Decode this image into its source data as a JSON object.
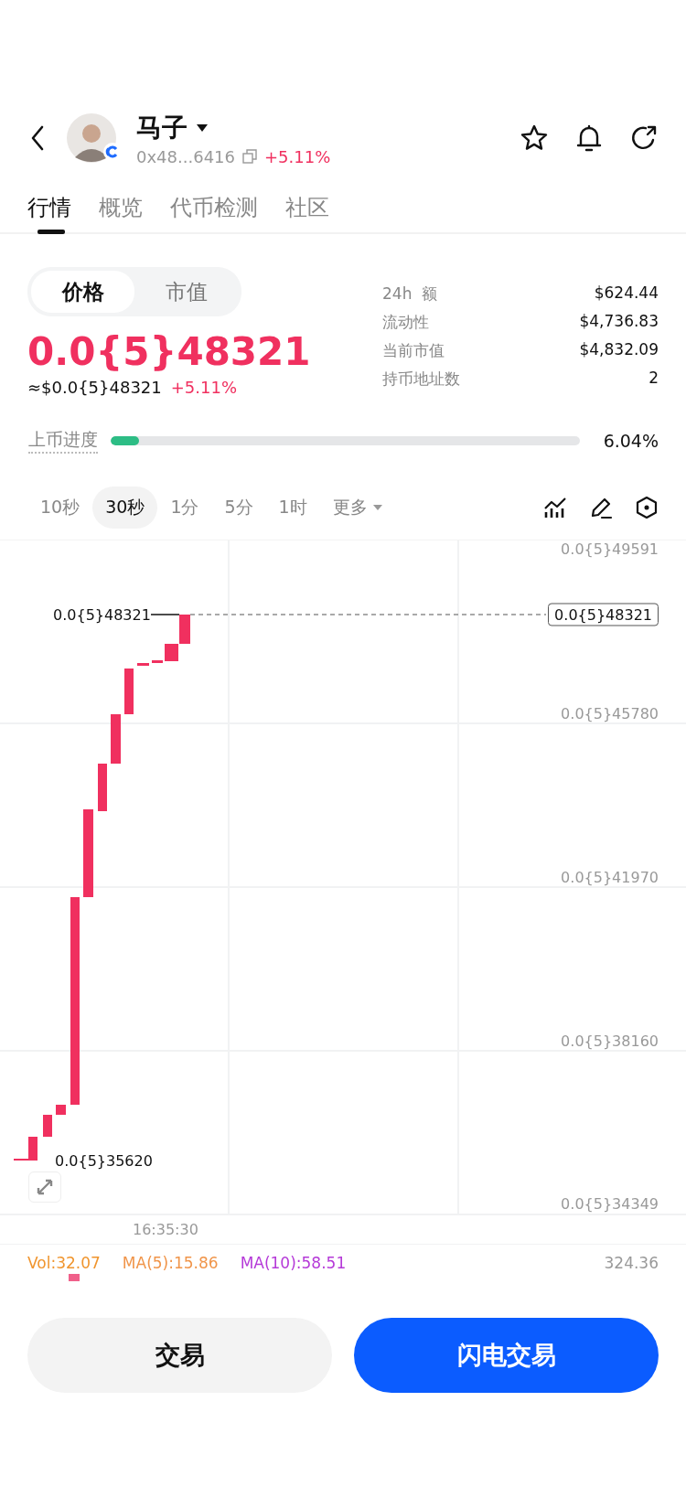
{
  "header": {
    "title": "马子",
    "address": "0x48...6416",
    "change": "+5.11%"
  },
  "tabs": [
    {
      "label": "行情",
      "selected": true
    },
    {
      "label": "概览",
      "selected": false
    },
    {
      "label": "代币检测",
      "selected": false
    },
    {
      "label": "社区",
      "selected": false
    }
  ],
  "mode_toggle": [
    {
      "label": "价格",
      "selected": true
    },
    {
      "label": "市值",
      "selected": false
    }
  ],
  "price": "0.0{5}48321",
  "price_usd": "≈$0.0{5}48321",
  "price_change": "+5.11%",
  "stats": [
    {
      "label": "24h  额",
      "value": "$624.44"
    },
    {
      "label": "流动性",
      "value": "$4,736.83"
    },
    {
      "label": "当前市值",
      "value": "$4,832.09"
    },
    {
      "label": "持币地址数",
      "value": "2"
    }
  ],
  "listing_progress": {
    "label": "上币进度",
    "level": 0.06,
    "reading": "6.04%"
  },
  "intervals": [
    {
      "label": "10秒",
      "selected": false,
      "kind": "option"
    },
    {
      "label": "30秒",
      "selected": true,
      "kind": "option"
    },
    {
      "label": "1分",
      "selected": false,
      "kind": "option"
    },
    {
      "label": "5分",
      "selected": false,
      "kind": "option"
    },
    {
      "label": "1时",
      "selected": false,
      "kind": "option"
    },
    {
      "label": "更多",
      "selected": false,
      "kind": "menu"
    }
  ],
  "chart": {
    "y_labels": [
      "0.0{5}49591",
      "0.0{5}45780",
      "0.0{5}41970",
      "0.0{5}38160",
      "0.0{5}34349"
    ],
    "high_label": "0.0{5}48321",
    "price_tag": "0.0{5}48321",
    "low_label": "0.0{5}35620",
    "time_label": "16:35:30"
  },
  "volume": {
    "vol": "Vol:32.07",
    "ma5": "MA(5):15.86",
    "ma10": "MA(10):58.51",
    "axis": "324.36"
  },
  "buttons": [
    {
      "label": "交易",
      "kind": "secondary"
    },
    {
      "label": "闪电交易",
      "kind": "primary"
    }
  ]
}
